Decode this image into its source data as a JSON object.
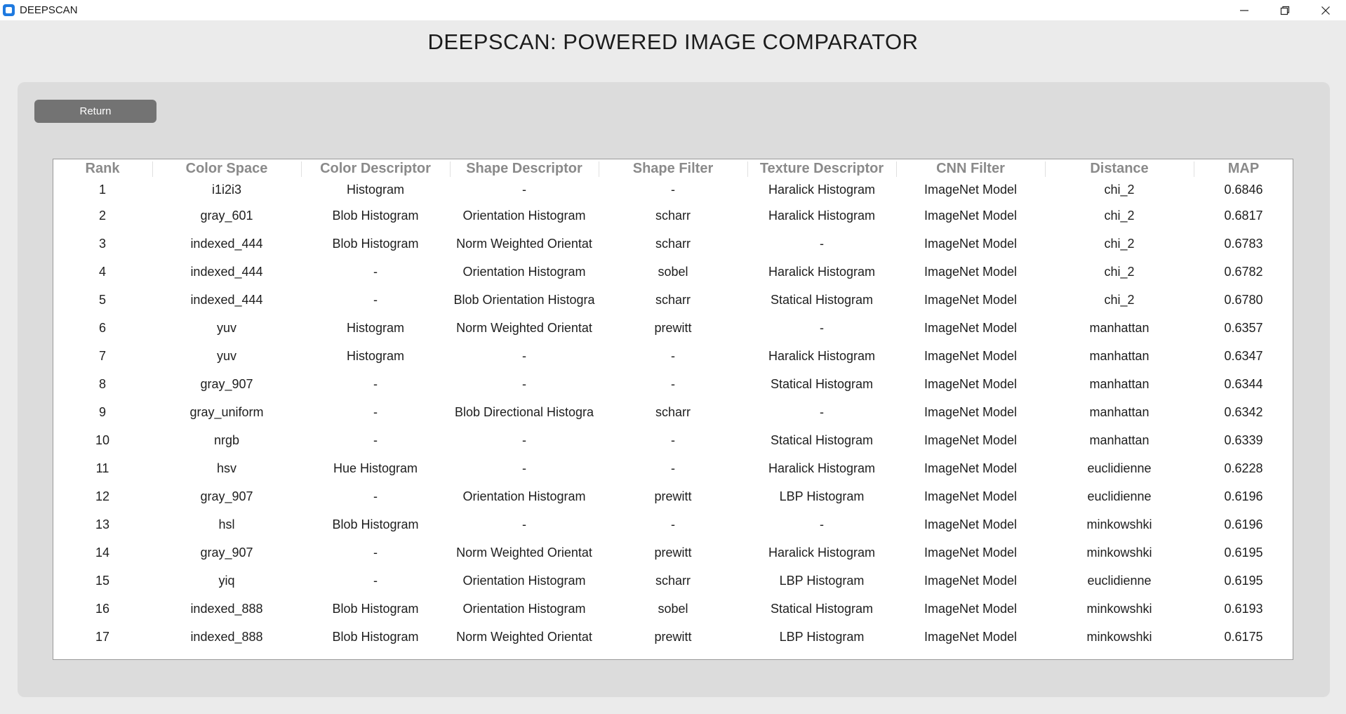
{
  "window": {
    "title": "DEEPSCAN",
    "controls": [
      "minimize-icon",
      "restore-icon",
      "close-icon"
    ]
  },
  "header": {
    "title": "DEEPSCAN: POWERED IMAGE COMPARATOR"
  },
  "panel": {
    "return_label": "Return"
  },
  "table": {
    "columns": [
      "Rank",
      "Color Space",
      "Color Descriptor",
      "Shape Descriptor",
      "Shape Filter",
      "Texture Descriptor",
      "CNN Filter",
      "Distance",
      "MAP"
    ],
    "rows": [
      [
        "1",
        "i1i2i3",
        "Histogram",
        "-",
        "-",
        "Haralick Histogram",
        "ImageNet Model",
        "chi_2",
        "0.6846"
      ],
      [
        "2",
        "gray_601",
        "Blob Histogram",
        "Orientation Histogram",
        "scharr",
        "Haralick Histogram",
        "ImageNet Model",
        "chi_2",
        "0.6817"
      ],
      [
        "3",
        "indexed_444",
        "Blob Histogram",
        "Norm Weighted Orientat",
        "scharr",
        "-",
        "ImageNet Model",
        "chi_2",
        "0.6783"
      ],
      [
        "4",
        "indexed_444",
        "-",
        "Orientation Histogram",
        "sobel",
        "Haralick Histogram",
        "ImageNet Model",
        "chi_2",
        "0.6782"
      ],
      [
        "5",
        "indexed_444",
        "-",
        "Blob Orientation Histogra",
        "scharr",
        "Statical Histogram",
        "ImageNet Model",
        "chi_2",
        "0.6780"
      ],
      [
        "6",
        "yuv",
        "Histogram",
        "Norm Weighted Orientat",
        "prewitt",
        "-",
        "ImageNet Model",
        "manhattan",
        "0.6357"
      ],
      [
        "7",
        "yuv",
        "Histogram",
        "-",
        "-",
        "Haralick Histogram",
        "ImageNet Model",
        "manhattan",
        "0.6347"
      ],
      [
        "8",
        "gray_907",
        "-",
        "-",
        "-",
        "Statical Histogram",
        "ImageNet Model",
        "manhattan",
        "0.6344"
      ],
      [
        "9",
        "gray_uniform",
        "-",
        "Blob Directional Histogra",
        "scharr",
        "-",
        "ImageNet Model",
        "manhattan",
        "0.6342"
      ],
      [
        "10",
        "nrgb",
        "-",
        "-",
        "-",
        "Statical Histogram",
        "ImageNet Model",
        "manhattan",
        "0.6339"
      ],
      [
        "11",
        "hsv",
        "Hue Histogram",
        "-",
        "-",
        "Haralick Histogram",
        "ImageNet Model",
        "euclidienne",
        "0.6228"
      ],
      [
        "12",
        "gray_907",
        "-",
        "Orientation Histogram",
        "prewitt",
        "LBP Histogram",
        "ImageNet Model",
        "euclidienne",
        "0.6196"
      ],
      [
        "13",
        "hsl",
        "Blob Histogram",
        "-",
        "-",
        "-",
        "ImageNet Model",
        "minkowshki",
        "0.6196"
      ],
      [
        "14",
        "gray_907",
        "-",
        "Norm Weighted Orientat",
        "prewitt",
        "Haralick Histogram",
        "ImageNet Model",
        "minkowshki",
        "0.6195"
      ],
      [
        "15",
        "yiq",
        "-",
        "Orientation Histogram",
        "scharr",
        "LBP Histogram",
        "ImageNet Model",
        "euclidienne",
        "0.6195"
      ],
      [
        "16",
        "indexed_888",
        "Blob Histogram",
        "Orientation Histogram",
        "sobel",
        "Statical Histogram",
        "ImageNet Model",
        "minkowshki",
        "0.6193"
      ],
      [
        "17",
        "indexed_888",
        "Blob Histogram",
        "Norm Weighted Orientat",
        "prewitt",
        "LBP Histogram",
        "ImageNet Model",
        "minkowshki",
        "0.6175"
      ]
    ]
  },
  "colors": {
    "accent": "#1f7ae0",
    "button": "#737373",
    "panel": "#dcdcdc",
    "background": "#ebebeb"
  }
}
